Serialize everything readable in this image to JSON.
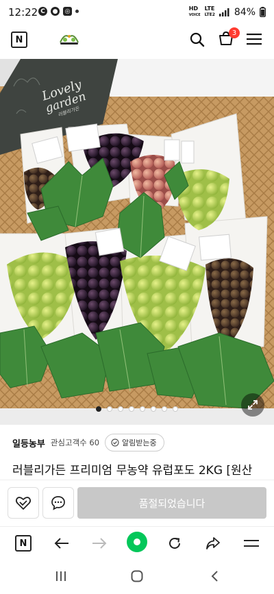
{
  "status_bar": {
    "time": "12:22",
    "lte_top": "LTE",
    "lte_bottom": "LTE2",
    "hd": "HD",
    "voice": "VOICE",
    "battery": "84%"
  },
  "header": {
    "n_label": "N",
    "cart_count": "3",
    "logo": "naver-farm-logo"
  },
  "gallery": {
    "slide_count": 8,
    "active_index": 0,
    "box_text_1": "Lovely",
    "box_text_2": "garden",
    "box_text_3": "러블리가든"
  },
  "seller": {
    "name": "일등농부",
    "fans_label": "관심고객수 60",
    "notify_label": "알림받는중"
  },
  "product": {
    "title": "러블리가든 프리미엄 무농약 유럽포도 2KG [원산"
  },
  "actions": {
    "soldout_label": "품절되었습니다"
  },
  "browser": {
    "n_label": "N"
  },
  "colors": {
    "green": "#03c75a",
    "badge": "#ff3b30",
    "soldout": "#c8c8c8"
  }
}
